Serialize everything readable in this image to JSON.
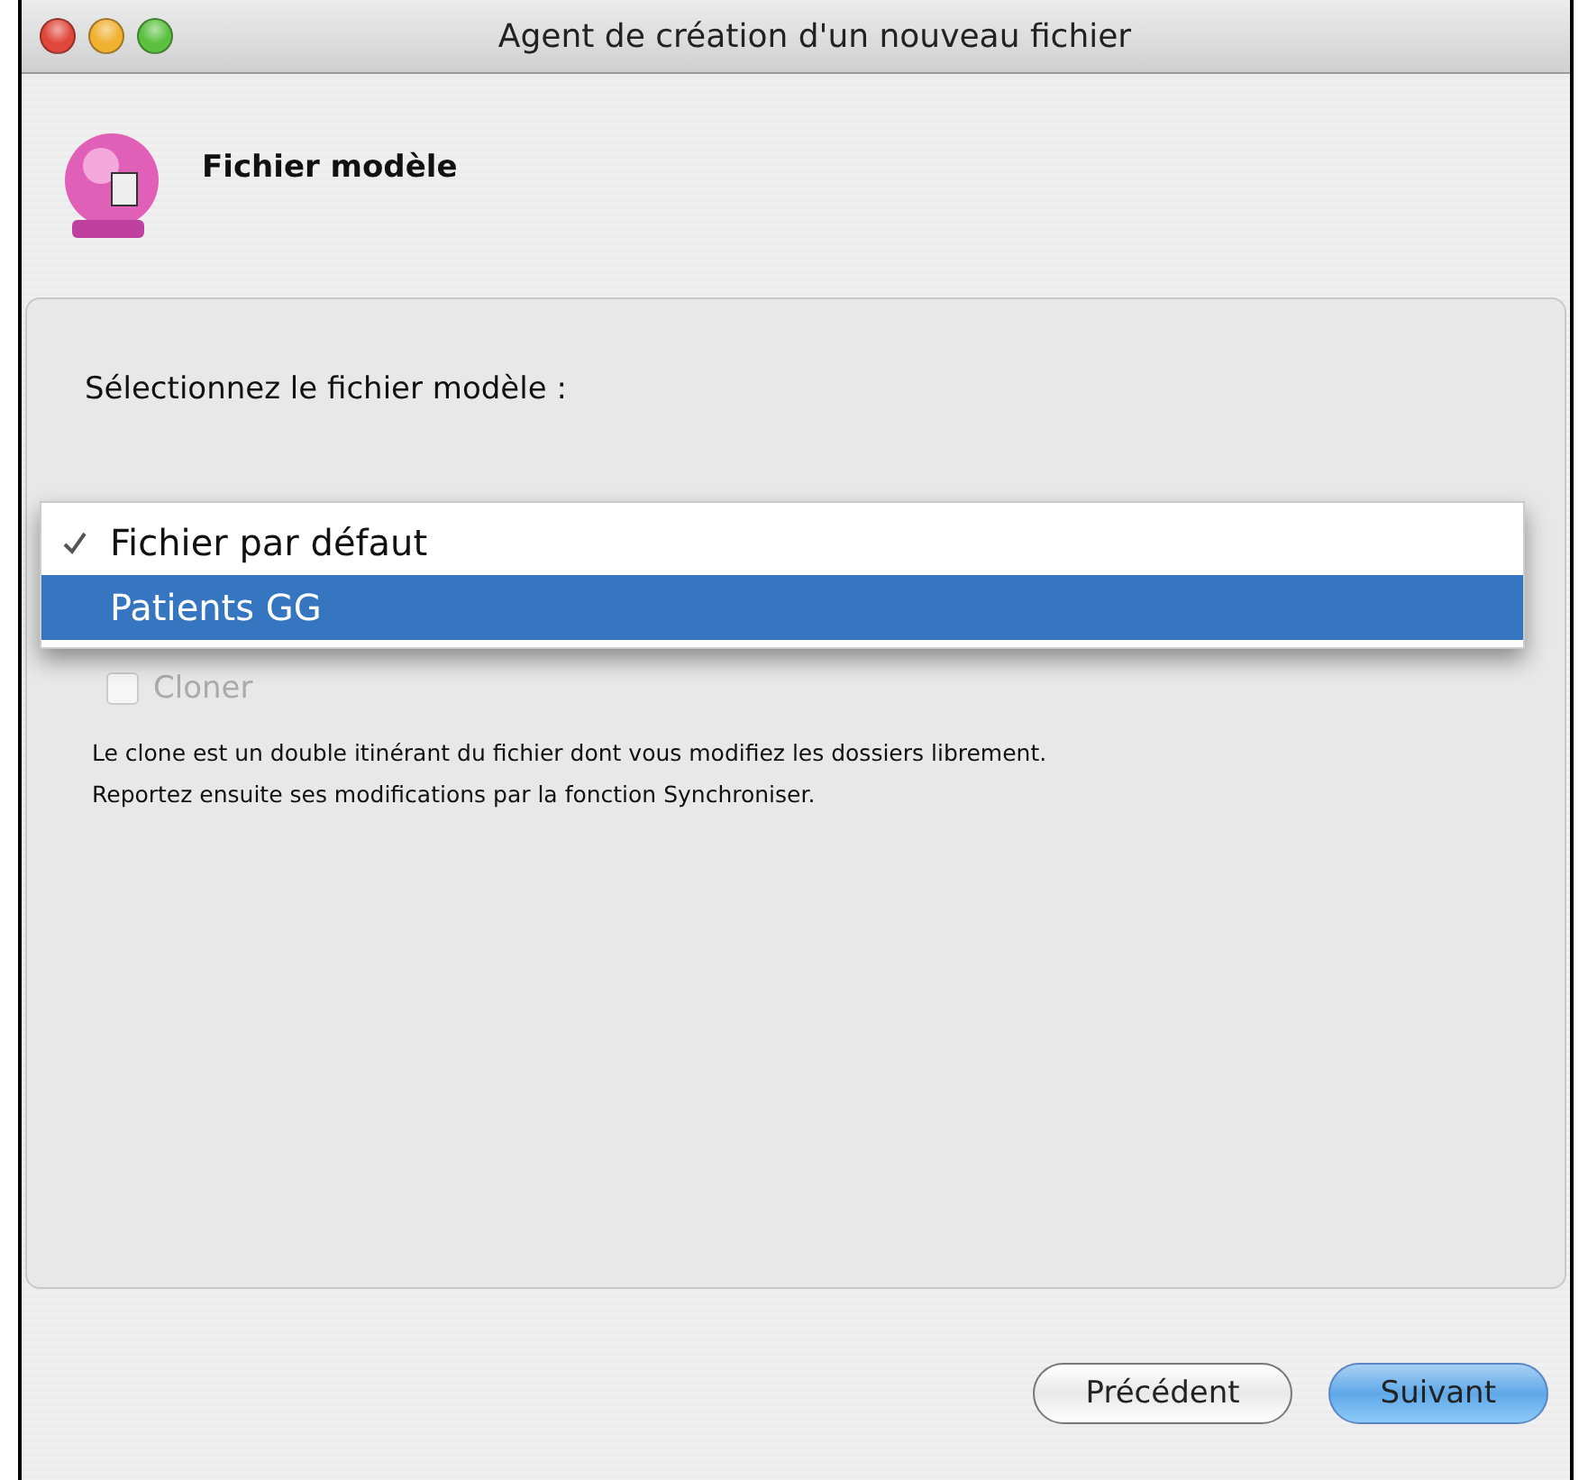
{
  "window": {
    "title": "Agent de création d'un nouveau fichier"
  },
  "header": {
    "title": "Fichier modèle"
  },
  "prompt": "Sélectionnez le fichier modèle :",
  "popup_menu": {
    "items": [
      {
        "label": "Fichier par défaut",
        "checked": true,
        "selected": false
      },
      {
        "label": "Patients GG",
        "checked": false,
        "selected": true
      }
    ]
  },
  "clone_option": {
    "label": "Cloner",
    "checked": false,
    "disabled": true
  },
  "description": [
    "Le clone est un double itinérant du fichier dont vous modifiez les dossiers librement.",
    "Reportez ensuite ses modifications par la fonction Synchroniser."
  ],
  "buttons": [
    {
      "label": "Précédent",
      "default": false
    },
    {
      "label": "Suivant",
      "default": true
    }
  ]
}
